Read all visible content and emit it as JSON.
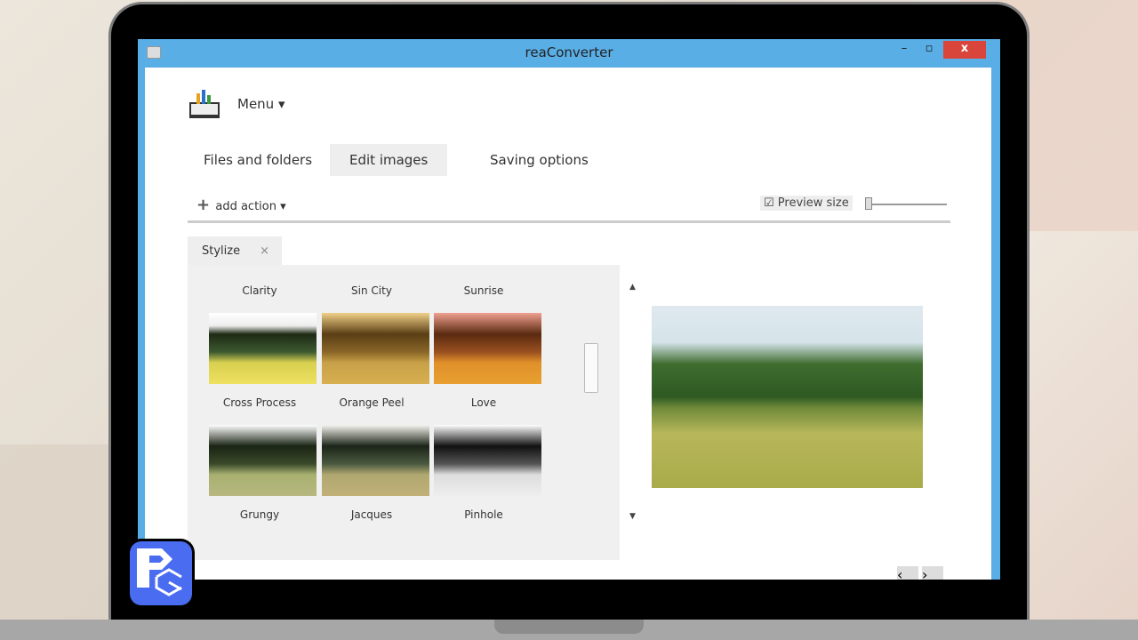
{
  "window": {
    "title": "reaConverter",
    "minimize": "–",
    "maximize": "▫",
    "close": "x"
  },
  "menu": {
    "label": "Menu ▾"
  },
  "tabs": [
    {
      "label": "Files and folders"
    },
    {
      "label": "Edit images"
    },
    {
      "label": "Saving options"
    }
  ],
  "toolbar": {
    "add_action": "add action ▾",
    "preview_size": "Preview size",
    "preview_checked": true
  },
  "style_tab": {
    "label": "Stylize",
    "close": "×"
  },
  "filters": {
    "row_labels_top": [
      "Clarity",
      "Sin City",
      "Sunrise"
    ],
    "row_labels_mid": [
      "Cross Process",
      "Orange Peel",
      "Love"
    ],
    "row_labels_bottom": [
      "Grungy",
      "Jacques",
      "Pinhole"
    ]
  },
  "scroll": {
    "up": "▲",
    "down": "▼",
    "thumb": "≡"
  },
  "nav": {
    "prev": "‹",
    "next": "›"
  }
}
